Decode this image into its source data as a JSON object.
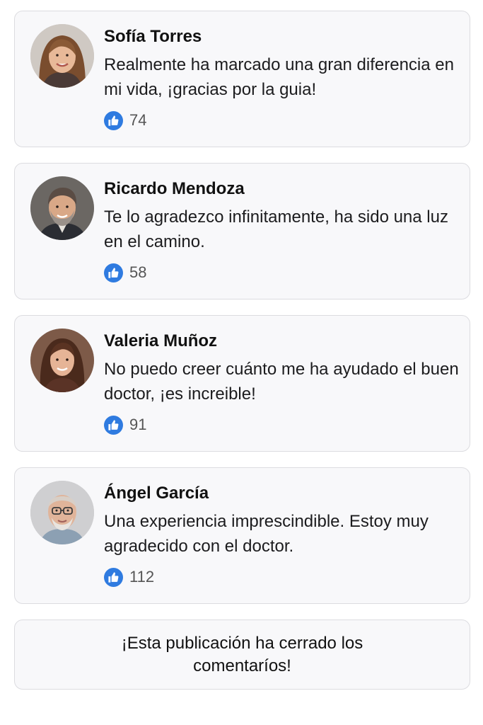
{
  "comments": [
    {
      "author": "Sofía Torres",
      "text": "Realmente ha marcado una gran diferencia en mi vida, ¡gracias por la guia!",
      "likes": "74",
      "avatar": "woman-brown-hair"
    },
    {
      "author": "Ricardo Mendoza",
      "text": "Te lo agradezco infinitamente, ha sido una luz en el camino.",
      "likes": "58",
      "avatar": "man-gray-beard"
    },
    {
      "author": "Valeria Muñoz",
      "text": "No puedo creer cuánto me ha ayudado el buen doctor, ¡es increible!",
      "likes": "91",
      "avatar": "woman-long-dark-hair"
    },
    {
      "author": "Ángel García",
      "text": "Una experiencia imprescindible. Estoy muy agradecido con el doctor.",
      "likes": "112",
      "avatar": "older-man-glasses"
    }
  ],
  "closed_notice": "¡Esta publicación ha cerrado los comentaríos!",
  "colors": {
    "like_blue": "#2f7be0",
    "card_bg": "#f8f8fa",
    "card_border": "#dcdce0"
  },
  "icons": {
    "like": "thumbs-up-icon"
  }
}
